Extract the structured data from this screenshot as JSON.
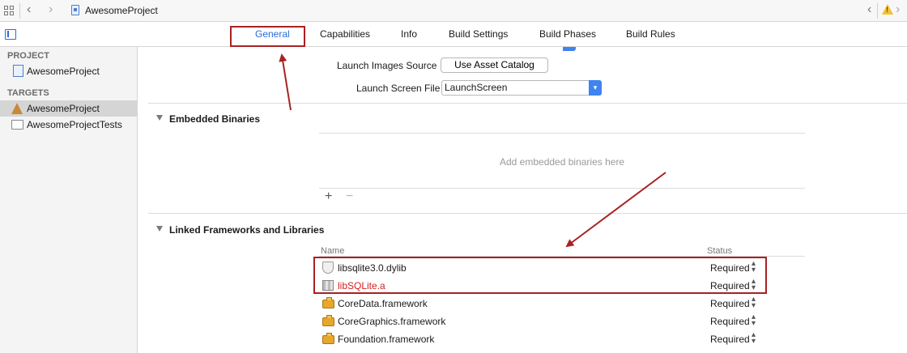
{
  "navbar": {
    "breadcrumb": "AwesomeProject",
    "back_glyph": "‹",
    "forward_glyph": "›",
    "warning_glyph": "!"
  },
  "tabs": [
    {
      "label": "General",
      "active": true
    },
    {
      "label": "Capabilities",
      "active": false
    },
    {
      "label": "Info",
      "active": false
    },
    {
      "label": "Build Settings",
      "active": false
    },
    {
      "label": "Build Phases",
      "active": false
    },
    {
      "label": "Build Rules",
      "active": false
    }
  ],
  "sidebar": {
    "project_heading": "PROJECT",
    "project_item": "AwesomeProject",
    "targets_heading": "TARGETS",
    "targets": [
      {
        "label": "AwesomeProject",
        "selected": true
      },
      {
        "label": "AwesomeProjectTests",
        "selected": false
      }
    ]
  },
  "launch": {
    "images_source_label": "Launch Images Source",
    "images_source_button": "Use Asset Catalog",
    "screen_file_label": "Launch Screen File",
    "screen_file_value": "LaunchScreen"
  },
  "embedded": {
    "title": "Embedded Binaries",
    "empty_message": "Add embedded binaries here",
    "add_glyph": "+",
    "remove_glyph": "−"
  },
  "linked": {
    "title": "Linked Frameworks and Libraries",
    "col_name": "Name",
    "col_status": "Status",
    "rows": [
      {
        "name": "libsqlite3.0.dylib",
        "status": "Required",
        "icon": "dylib-icon"
      },
      {
        "name": "libSQLite.a",
        "status": "Required",
        "icon": "archive-icon"
      },
      {
        "name": "CoreData.framework",
        "status": "Required",
        "icon": "framework-icon"
      },
      {
        "name": "CoreGraphics.framework",
        "status": "Required",
        "icon": "framework-icon"
      },
      {
        "name": "Foundation.framework",
        "status": "Required",
        "icon": "framework-icon"
      }
    ]
  },
  "colors": {
    "accent": "#2a6cdb",
    "annotation": "#a82222",
    "missing_library": "#d21f1f"
  }
}
